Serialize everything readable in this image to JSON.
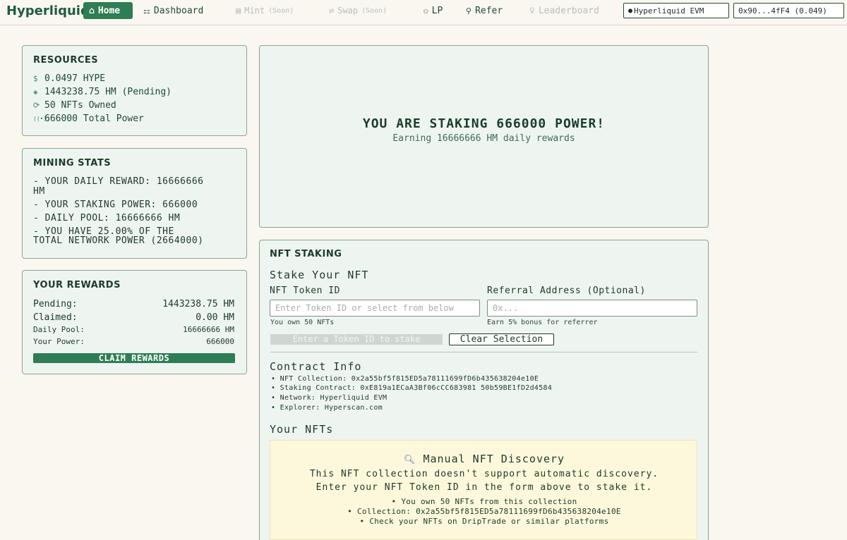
{
  "nav": {
    "brand": "Hyperliquid",
    "items": [
      {
        "label": "Home",
        "icon": "home-icon"
      },
      {
        "label": "Dashboard",
        "icon": "grid-icon"
      },
      {
        "label": "Mint",
        "soon": "(Soon)",
        "icon": "coins-icon"
      },
      {
        "label": "Swap",
        "soon": "(Soon)",
        "icon": "swap-icon"
      },
      {
        "label": "LP",
        "icon": "users-icon"
      },
      {
        "label": "Refer",
        "icon": "user-icon"
      },
      {
        "label": "Leaderboard",
        "icon": "trophy-icon"
      }
    ],
    "network": "Hyperliquid EVM",
    "wallet": "0x90...4fF4 (0.049)"
  },
  "resources": {
    "title": "RESOURCES",
    "hype": "0.0497 HYPE",
    "hm": "1443238.75 HM (Pending)",
    "nfts": "50 NFTs Owned",
    "power": "666000 Total Power"
  },
  "mining": {
    "title": "MINING STATS",
    "daily_reward": "- YOUR DAILY REWARD: 16666666",
    "daily_reward_unit": "HM",
    "staking_power": "- YOUR STAKING POWER: 666000",
    "daily_pool": "- DAILY POOL: 16666666 HM",
    "share_1": "- YOU HAVE 25.00% OF THE",
    "share_2": "TOTAL NETWORK POWER (2664000)"
  },
  "rewards": {
    "title": "YOUR REWARDS",
    "pending_label": "Pending:",
    "pending_value": "1443238.75 HM",
    "claimed_label": "Claimed:",
    "claimed_value": "0.00 HM",
    "pool_label": "Daily Pool:",
    "pool_value": "16666666 HM",
    "power_label": "Your Power:",
    "power_value": "666000",
    "claim_button": "CLAIM REWARDS"
  },
  "hero": {
    "title": "YOU ARE STAKING 666000 POWER!",
    "subtitle": "Earning 16666666 HM daily rewards"
  },
  "staking": {
    "title": "NFT STAKING",
    "stake_heading": "Stake Your NFT",
    "token_label": "NFT Token ID",
    "token_placeholder": "Enter Token ID or select from below",
    "own_hint": "You own 50 NFTs",
    "referral_label": "Referral Address (Optional)",
    "referral_placeholder": "0x...",
    "referral_hint": "Earn 5% bonus for referrer",
    "stake_button": "Enter a Token ID to stake",
    "clear_button": "Clear Selection",
    "contract_heading": "Contract Info",
    "contract_lines": [
      "• NFT Collection: 0x2a55bf5f815ED5a78111699fD6b435638204e10E",
      "• Staking Contract: 0xE819a1ECaA3Bf06cCC683981 50b59BE1fD2d4584",
      "• Network: Hyperliquid EVM",
      "• Explorer: Hyperscan.com"
    ],
    "your_nfts": "Your NFTs"
  },
  "discovery": {
    "title": "Manual NFT Discovery",
    "text_1": "This NFT collection doesn't support automatic discovery.",
    "text_2": "Enter your NFT Token ID in the form above to stake it.",
    "list": [
      "• You own 50 NFTs from this collection",
      "• Collection: 0x2a55bf5f815ED5a78111699fD6b435638204e10E",
      "• Check your NFTs on DripTrade or similar platforms"
    ]
  },
  "colors": {
    "accent": "#2e7d55",
    "background": "#faf6f0",
    "card": "#eef5f0",
    "notice": "#fdf8dc"
  }
}
